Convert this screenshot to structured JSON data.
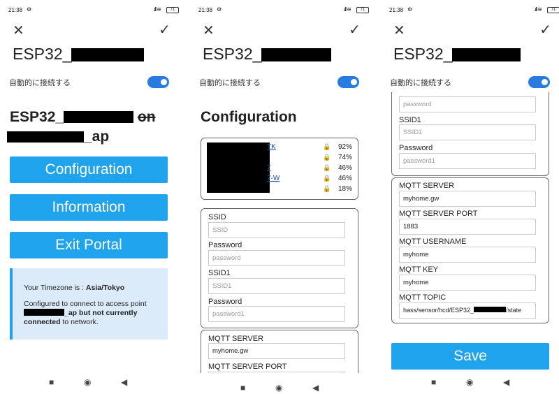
{
  "status": {
    "time": "21:38",
    "battery": "71"
  },
  "header": {
    "ssid_prefix": "ESP32_",
    "auto_connect": "自動的に接続する"
  },
  "panel1": {
    "title_prefix": "ESP32_",
    "title_strike": "on",
    "title_suffix": "_ap",
    "buttons": [
      "Configuration",
      "Information",
      "Exit Portal"
    ],
    "tz_label": "Your Timezone is : ",
    "tz_value": "Asia/Tokyo",
    "msg1": "Configured to connect to access point",
    "msg2": "_ap but not currently",
    "msg3": "connected",
    "msg4": " to network."
  },
  "panel2": {
    "title": "Configuration",
    "wifi": [
      {
        "link": "TK",
        "pct": "92%"
      },
      {
        "link": "",
        "pct": "74%"
      },
      {
        "link": "7",
        "pct": "46%"
      },
      {
        "link": "7-W",
        "pct": "46%"
      },
      {
        "link": "",
        "pct": "18%"
      }
    ],
    "ssid_label": "SSID",
    "ssid_ph": "SSID",
    "pw_label": "Password",
    "pw_ph": "password",
    "ssid1_label": "SSID1",
    "ssid1_ph": "SSID1",
    "pw1_label": "Password",
    "pw1_ph": "password1",
    "mqtt_server_label": "MQTT SERVER",
    "mqtt_server_val": "myhome.gw",
    "mqtt_port_label": "MQTT SERVER PORT"
  },
  "panel3": {
    "pw_ph": "password",
    "ssid1_label": "SSID1",
    "ssid1_ph": "SSID1",
    "pw1_label": "Password",
    "pw1_ph": "password1",
    "mqtt_server_label": "MQTT SERVER",
    "mqtt_server_val": "myhome.gw",
    "mqtt_port_label": "MQTT SERVER PORT",
    "mqtt_port_val": "1883",
    "mqtt_user_label": "MQTT USERNAME",
    "mqtt_user_val": "myhome",
    "mqtt_key_label": "MQTT KEY",
    "mqtt_key_val": "myhome",
    "mqtt_topic_label": "MQTT TOPIC",
    "mqtt_topic_pre": "hass/sensor/hcd/ESP32_",
    "mqtt_topic_post": "/state",
    "save": "Save"
  },
  "nav": {
    "square": "■",
    "circle": "◉",
    "back": "◀"
  },
  "icons": {
    "close": "close-icon",
    "check": "check-icon",
    "lock": "lock-icon"
  },
  "colors": {
    "accent": "#1fa3ec",
    "toggle": "#2a7bdf",
    "info_bg": "#dcebfa"
  }
}
